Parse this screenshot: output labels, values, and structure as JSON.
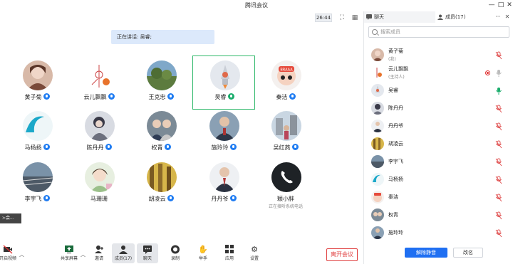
{
  "window": {
    "title": "腾讯会议",
    "min": "—",
    "max": "□",
    "close": "✕"
  },
  "stage": {
    "timer": "26:44",
    "speaking": "正在讲话: 吴睿;"
  },
  "participants": [
    {
      "name": "黄子菊",
      "mic": "blue"
    },
    {
      "name": "云儿飘飘",
      "mic": "blue"
    },
    {
      "name": "王克忠",
      "mic": "blue"
    },
    {
      "name": "吴睿",
      "mic": "green"
    },
    {
      "name": "秦洁",
      "mic": "blue"
    },
    {
      "name": "马杨扬",
      "mic": "blue"
    },
    {
      "name": "陈丹丹",
      "mic": "blue"
    },
    {
      "name": "权青",
      "mic": "blue"
    },
    {
      "name": "施玲玲",
      "mic": "blue"
    },
    {
      "name": "吴红燕",
      "mic": "blue"
    },
    {
      "name": "李宇飞",
      "mic": "blue"
    },
    {
      "name": "马珊珊",
      "mic": "none"
    },
    {
      "name": "胡凌云",
      "mic": "blue"
    },
    {
      "name": "丹丹爷",
      "mic": "blue"
    },
    {
      "name": "颖小胖",
      "mic": "none",
      "status": "正在接听系统电话"
    }
  ],
  "toast": "≻会...",
  "toolbar": {
    "video": "开启视频",
    "share": "共享屏幕",
    "invite": "邀请",
    "members": "成员(17)",
    "chat": "聊天",
    "record": "录制",
    "raise": "举手",
    "apps": "应用",
    "settings": "设置",
    "leave": "离开会议"
  },
  "panel": {
    "tab_chat": "聊天",
    "tab_members": "成员(17)",
    "more": "···",
    "close": "✕",
    "search_placeholder": "搜索成员",
    "members": [
      {
        "name": "黄子菊",
        "role": "(我)",
        "mic": "muted"
      },
      {
        "name": "云儿飘飘",
        "role": "(主持人)",
        "mic": "off",
        "recording": true
      },
      {
        "name": "吴睿",
        "role": "",
        "mic": "active"
      },
      {
        "name": "陈丹丹",
        "role": "",
        "mic": "muted"
      },
      {
        "name": "丹丹爷",
        "role": "",
        "mic": "muted"
      },
      {
        "name": "胡凌云",
        "role": "",
        "mic": "muted"
      },
      {
        "name": "李宇飞",
        "role": "",
        "mic": "muted"
      },
      {
        "name": "马杨扬",
        "role": "",
        "mic": "muted"
      },
      {
        "name": "秦洁",
        "role": "",
        "mic": "muted"
      },
      {
        "name": "权青",
        "role": "",
        "mic": "muted"
      },
      {
        "name": "施玲玲",
        "role": "",
        "mic": "muted"
      }
    ],
    "mute_all": "解除静音",
    "rename": "改名"
  },
  "colors": {
    "accent": "#1f6ff2",
    "active_border": "#2fb86a",
    "leave": "#e04040",
    "muted": "#e05050"
  }
}
